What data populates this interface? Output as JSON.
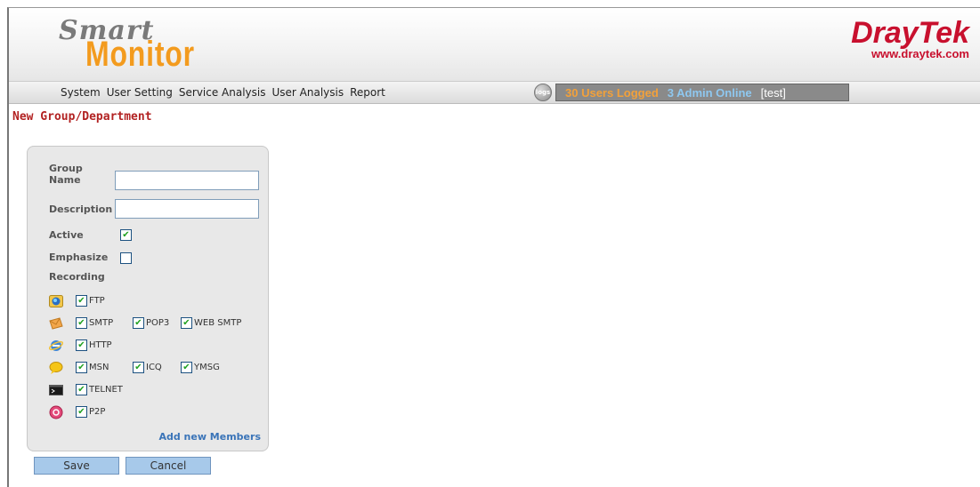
{
  "header": {
    "logo_top": "Smart",
    "logo_bottom": "Monitor",
    "brand_name": "DrayTek",
    "brand_url": "www.draytek.com"
  },
  "nav": {
    "items": [
      "System",
      "User Setting",
      "Service Analysis",
      "User Analysis",
      "Report"
    ]
  },
  "status": {
    "icon_label": "logs",
    "users_logged": "30 Users Logged",
    "admin_online": "3 Admin Online",
    "current_user": "[test]"
  },
  "page": {
    "title": "New Group/Department"
  },
  "form": {
    "group_name_label_1": "Group",
    "group_name_label_2": "Name",
    "group_name_value": "",
    "description_label": "Description",
    "description_value": "",
    "active_label": "Active",
    "active_checked": true,
    "emphasize_label": "Emphasize",
    "emphasize_checked": false,
    "recording_label": "Recording",
    "protocols": {
      "ftp": "FTP",
      "smtp": "SMTP",
      "pop3": "POP3",
      "web_smtp": "WEB SMTP",
      "http": "HTTP",
      "msn": "MSN",
      "icq": "ICQ",
      "ymsg": "YMSG",
      "telnet": "TELNET",
      "p2p": "P2P"
    },
    "add_members": "Add new Members"
  },
  "buttons": {
    "save": "Save",
    "cancel": "Cancel"
  },
  "colors": {
    "brand": "#c8102e",
    "logo_accent": "#f39b1e",
    "title": "#b22222",
    "link": "#3a74b8",
    "button": "#a7c9ea"
  }
}
